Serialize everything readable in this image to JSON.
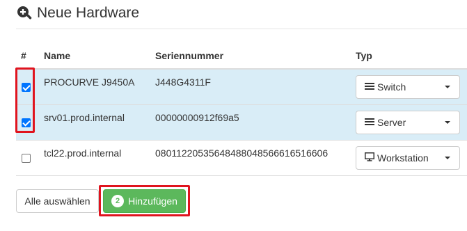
{
  "header": {
    "title": "Neue Hardware",
    "icon": "zoom-in-icon"
  },
  "table": {
    "columns": {
      "select": "#",
      "name": "Name",
      "serial": "Seriennummer",
      "type": "Typ"
    },
    "rows": [
      {
        "checked": true,
        "name": "PROCURVE J9450A",
        "serial": "J448G4311F",
        "type": "Switch",
        "type_icon": "list-icon"
      },
      {
        "checked": true,
        "name": "srv01.prod.internal",
        "serial": "00000000912f69a5",
        "type": "Server",
        "type_icon": "list-icon"
      },
      {
        "checked": false,
        "name": "tcl22.prod.internal",
        "serial": "0801122053564848804856661651660​6",
        "type": "Workstation",
        "type_icon": "monitor-icon"
      }
    ]
  },
  "actions": {
    "select_all_label": "Alle auswählen",
    "add_label": "Hinzufügen",
    "add_count": "2"
  },
  "colors": {
    "selected_row": "#d9edf7",
    "success": "#5cb85c",
    "highlight": "#e0141e"
  }
}
